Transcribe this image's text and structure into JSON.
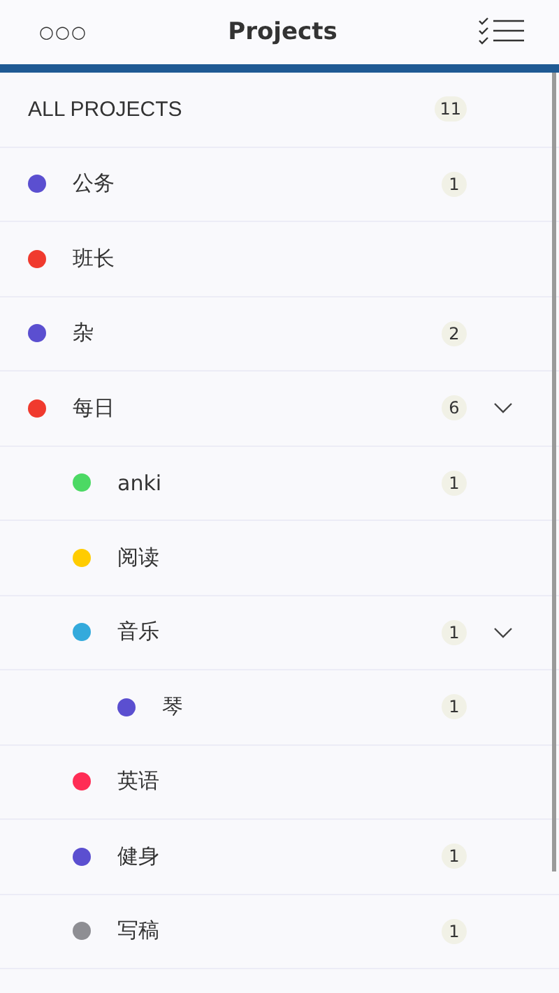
{
  "header": {
    "menu": "○○○",
    "title": "Projects"
  },
  "all_projects": {
    "label": "ALL PROJECTS",
    "count": "11"
  },
  "projects": [
    {
      "name": "公务",
      "color": "#5b4fd0",
      "count": "1"
    },
    {
      "name": "班长",
      "color": "#f03a2e"
    },
    {
      "name": "杂",
      "color": "#5b4fd0",
      "count": "2"
    },
    {
      "name": "每日",
      "color": "#f03a2e",
      "count": "6",
      "expanded": true,
      "children": [
        {
          "name": "anki",
          "color": "#4cd964",
          "count": "1"
        },
        {
          "name": "阅读",
          "color": "#ffcc00"
        },
        {
          "name": "音乐",
          "color": "#34aadc",
          "count": "1",
          "expanded": true,
          "children": [
            {
              "name": "琴",
              "color": "#5b4fd0",
              "count": "1"
            }
          ]
        },
        {
          "name": "英语",
          "color": "#ff2d55"
        },
        {
          "name": "健身",
          "color": "#5b4fd0",
          "count": "1"
        },
        {
          "name": "写稿",
          "color": "#8e8e93",
          "count": "1"
        }
      ]
    }
  ]
}
